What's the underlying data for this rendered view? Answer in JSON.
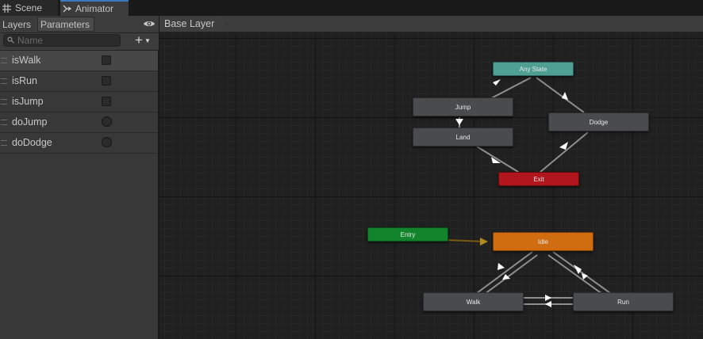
{
  "tabs": {
    "scene": {
      "label": "Scene",
      "icon": "grid-icon"
    },
    "animator": {
      "label": "Animator",
      "icon": "animator-icon"
    }
  },
  "left_panel": {
    "tabs": {
      "layers": "Layers",
      "parameters": "Parameters"
    },
    "search_placeholder": "Name",
    "add_label": "+",
    "parameters": [
      {
        "name": "isWalk",
        "type": "bool"
      },
      {
        "name": "isRun",
        "type": "bool"
      },
      {
        "name": "isJump",
        "type": "bool"
      },
      {
        "name": "doJump",
        "type": "trigger"
      },
      {
        "name": "doDodge",
        "type": "trigger"
      }
    ]
  },
  "graph": {
    "breadcrumb": "Base Layer",
    "states": {
      "any_state": "Any State",
      "jump": "Jump",
      "dodge": "Dodge",
      "land": "Land",
      "exit": "Exit",
      "entry": "Entry",
      "idle": "Idle",
      "walk": "Walk",
      "run": "Run"
    }
  },
  "colors": {
    "any_state": "#4f9f93",
    "exit": "#b0161b",
    "entry": "#12852c",
    "idle": "#d06d10",
    "state": "#4a4b4e",
    "accent_tab": "#3a79bb"
  }
}
